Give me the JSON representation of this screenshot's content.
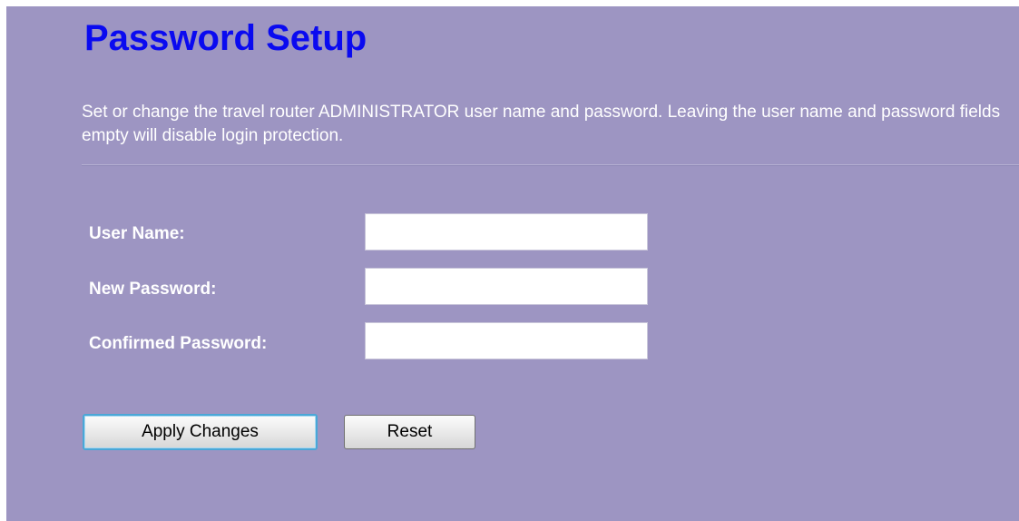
{
  "page": {
    "title": "Password Setup",
    "description": "Set or change the travel router ADMINISTRATOR user name and password. Leaving the user name and password fields empty will disable login protection."
  },
  "form": {
    "username_label": "User Name:",
    "username_value": "",
    "new_password_label": "New Password:",
    "new_password_value": "",
    "confirm_password_label": "Confirmed Password:",
    "confirm_password_value": ""
  },
  "buttons": {
    "apply": "Apply Changes",
    "reset": "Reset"
  },
  "colors": {
    "background": "#9d95c2",
    "title": "#0a0af0",
    "text": "#ffffff",
    "apply_focus_border": "#4aa7d7"
  }
}
